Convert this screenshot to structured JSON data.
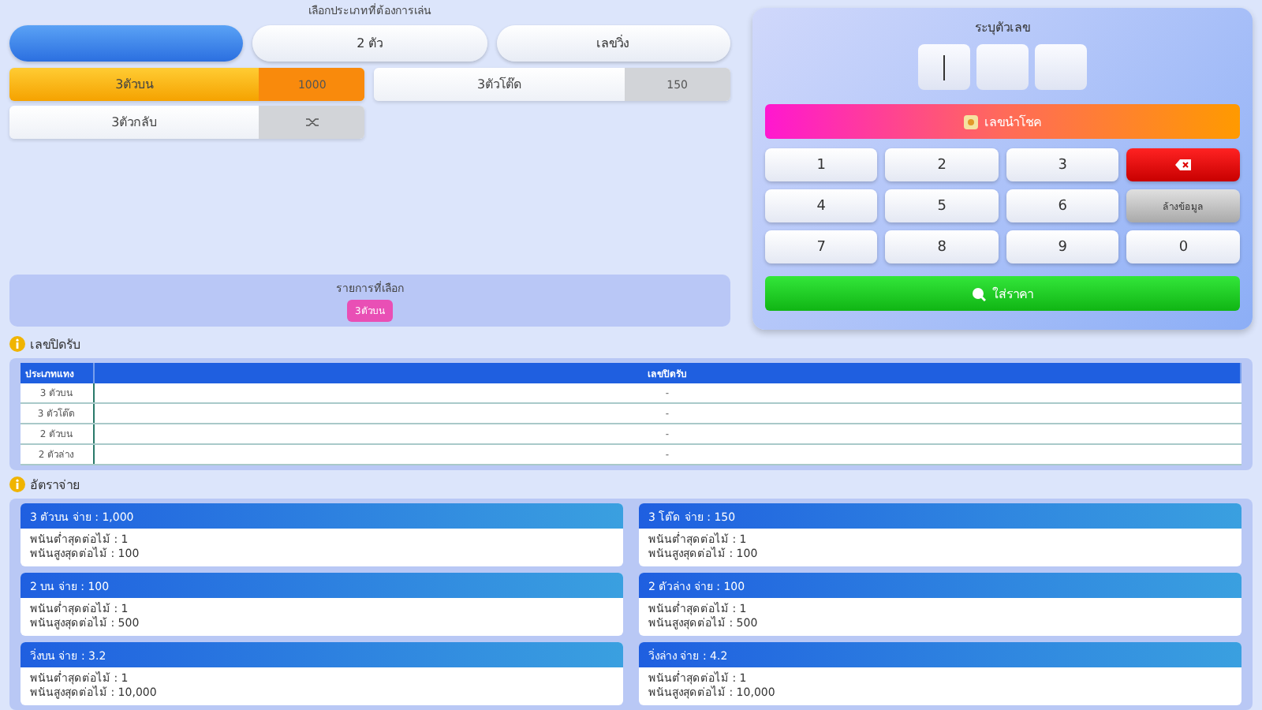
{
  "bet_type_picker": {
    "title": "เลือกประเภทที่ต้องการเล่น",
    "tabs": [
      {
        "selected": true
      },
      {
        "label": "2 ตัว",
        "selected": false
      },
      {
        "label": "เลขวิ่ง",
        "selected": false
      }
    ],
    "options": [
      {
        "kind": "price",
        "label": "3ตัวบน",
        "value": "1000",
        "selected": true
      },
      {
        "kind": "price",
        "label": "3ตัวโต๊ด",
        "value": "150",
        "selected": false
      },
      {
        "kind": "shuffle",
        "label": "3ตัวกลับ",
        "selected": false
      }
    ]
  },
  "selected_list": {
    "title": "รายการที่เลือก",
    "chips": [
      "3ตัวบน"
    ]
  },
  "number_entry": {
    "title": "ระบุตัวเลข",
    "digit_boxes": [
      {
        "focused": true
      },
      {
        "focused": false
      },
      {
        "focused": false
      }
    ],
    "lucky_button": "เลขนำโชค",
    "keypad": [
      {
        "kind": "digit",
        "label": "1"
      },
      {
        "kind": "digit",
        "label": "2"
      },
      {
        "kind": "digit",
        "label": "3"
      },
      {
        "kind": "backspace"
      },
      {
        "kind": "digit",
        "label": "4"
      },
      {
        "kind": "digit",
        "label": "5"
      },
      {
        "kind": "digit",
        "label": "6"
      },
      {
        "kind": "clear",
        "label": "ล้างข้อมูล"
      },
      {
        "kind": "digit",
        "label": "7"
      },
      {
        "kind": "digit",
        "label": "8"
      },
      {
        "kind": "digit",
        "label": "9"
      },
      {
        "kind": "digit",
        "label": "0"
      }
    ],
    "price_button": "ใส่ราคา"
  },
  "closed_numbers": {
    "title": "เลขปิดรับ",
    "columns": [
      "ประเภทแทง",
      "เลขปิดรับ"
    ],
    "rows": [
      [
        "3 ตัวบน",
        "-"
      ],
      [
        "3 ตัวโต๊ด",
        "-"
      ],
      [
        "2 ตัวบน",
        "-"
      ],
      [
        "2 ตัวล่าง",
        "-"
      ]
    ]
  },
  "payout_rates": {
    "title": "อัตราจ่าย",
    "cards": [
      {
        "title": "3 ตัวบน จ่าย : 1,000",
        "lines": [
          "พนันต่ำสุดต่อไม้ : 1",
          "พนันสูงสุดต่อไม้ : 100"
        ]
      },
      {
        "title": "3 โต๊ด จ่าย : 150",
        "lines": [
          "พนันต่ำสุดต่อไม้ : 1",
          "พนันสูงสุดต่อไม้ : 100"
        ]
      },
      {
        "title": "2 บน จ่าย : 100",
        "lines": [
          "พนันต่ำสุดต่อไม้ : 1",
          "พนันสูงสุดต่อไม้ : 500"
        ]
      },
      {
        "title": "2 ตัวล่าง จ่าย : 100",
        "lines": [
          "พนันต่ำสุดต่อไม้ : 1",
          "พนันสูงสุดต่อไม้ : 500"
        ]
      },
      {
        "title": "วิ่งบน จ่าย : 3.2",
        "lines": [
          "พนันต่ำสุดต่อไม้ : 1",
          "พนันสูงสุดต่อไม้ : 10,000"
        ]
      },
      {
        "title": "วิ่งล่าง จ่าย : 4.2",
        "lines": [
          "พนันต่ำสุดต่อไม้ : 1",
          "พนันสูงสุดต่อไม้ : 10,000"
        ]
      }
    ]
  }
}
